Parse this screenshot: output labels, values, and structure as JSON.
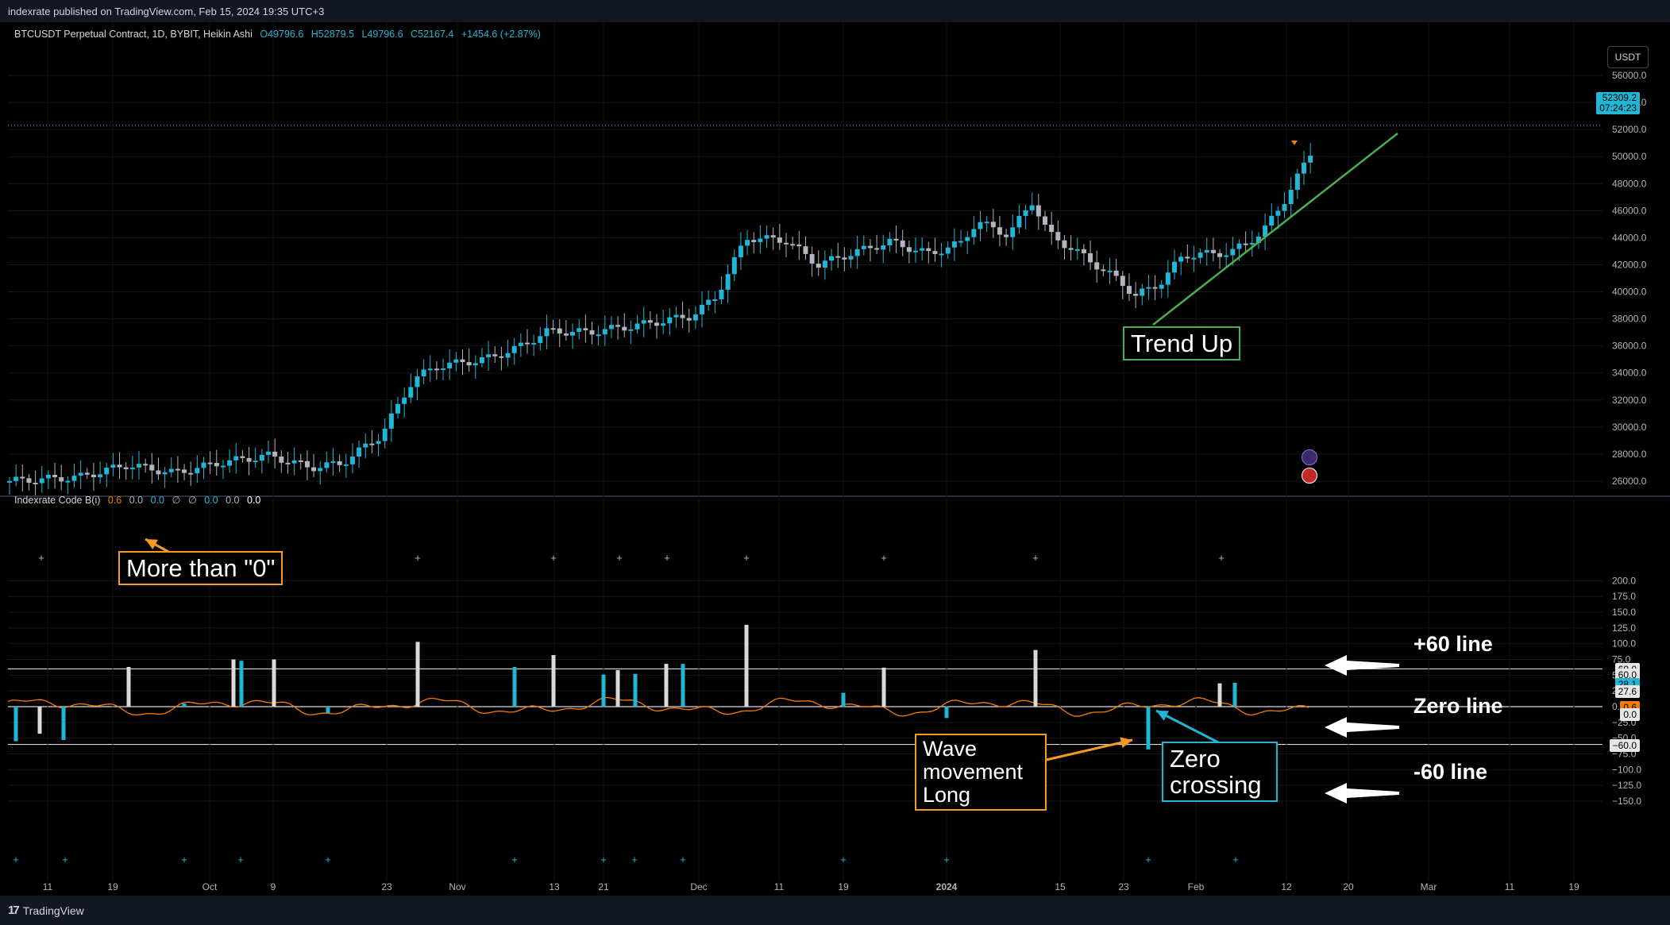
{
  "header": {
    "publisher": "indexrate published on TradingView.com, Feb 15, 2024 19:35 UTC+3"
  },
  "symbol": {
    "name": "BTCUSDT Perpetual Contract, 1D, BYBIT, Heikin Ashi",
    "open": "O49796.6",
    "high": "H52879.5",
    "low": "L49796.6",
    "close": "C52167.4",
    "change": "+1454.6 (+2.87%)"
  },
  "currency_button": "USDT",
  "price_axis": {
    "ticks": [
      "26000.0",
      "28000.0",
      "30000.0",
      "32000.0",
      "34000.0",
      "36000.0",
      "38000.0",
      "40000.0",
      "42000.0",
      "44000.0",
      "46000.0",
      "48000.0",
      "50000.0",
      "52000.0",
      "54000.0",
      "56000.0"
    ],
    "last_price": "52309.2",
    "countdown": "07:24:23"
  },
  "indicator": {
    "name": "Indexrate Code B(i)",
    "values": [
      "0.6",
      "0.0",
      "0.0",
      "∅",
      "∅",
      "0.0",
      "0.0",
      "0.0"
    ],
    "axis_ticks": [
      "200.0",
      "175.0",
      "150.0",
      "125.0",
      "100.0",
      "75.0",
      "50.0",
      "25.0",
      "0.0",
      "−25.0",
      "−50.0",
      "−75.0",
      "−100.0",
      "−125.0",
      "−150.0"
    ],
    "tags": [
      {
        "text": "60.0",
        "value": 60,
        "bg": "#e6e6e6",
        "fg": "#000000"
      },
      {
        "text": "60.0",
        "value": 52,
        "bg": "#e6e6e6",
        "fg": "#000000"
      },
      {
        "text": "28.1",
        "value": 36,
        "bg": "#22b5d4",
        "fg": "#000000"
      },
      {
        "text": "27.6",
        "value": 25,
        "bg": "#e6e6e6",
        "fg": "#000000"
      },
      {
        "text": "0.6",
        "value": 0,
        "bg": "#f57c00",
        "fg": "#000000"
      },
      {
        "text": "0.0",
        "value": -11,
        "bg": "#e6e6e6",
        "fg": "#000000"
      },
      {
        "text": "−60.0",
        "value": -60,
        "bg": "#e6e6e6",
        "fg": "#000000"
      }
    ]
  },
  "time_axis": [
    "11",
    "19",
    "Oct",
    "9",
    "23",
    "Nov",
    "13",
    "21",
    "Dec",
    "11",
    "19",
    "2024",
    "15",
    "23",
    "Feb",
    "12",
    "20",
    "Mar",
    "11",
    "19"
  ],
  "annotations": {
    "more_than_zero": "More than \"0\"",
    "trend_up": "Trend Up",
    "wave_movement": [
      "Wave",
      "movement",
      "Long"
    ],
    "zero_crossing": [
      "Zero",
      "crossing"
    ],
    "plus60_line": "+60 line",
    "zero_line": "Zero line",
    "minus60_line": "-60 line"
  },
  "footer": {
    "brand": "TradingView"
  },
  "colors": {
    "up_candle": "#22b5d4",
    "down_candle": "#b2b5be",
    "oscillator": "#f57c00",
    "trend_line": "#4caf50",
    "annotation_orange": "#f59a23",
    "annotation_cyan": "#22b5d4"
  }
}
